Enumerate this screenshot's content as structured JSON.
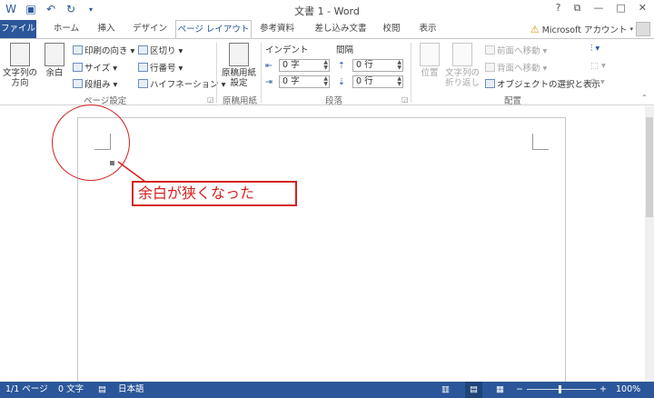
{
  "window": {
    "title": "文書 1 - Word",
    "controls": [
      "?",
      "⧉",
      "—",
      "□",
      "✕"
    ]
  },
  "qat": {
    "icons": [
      "word-logo-icon",
      "save-icon",
      "undo-icon",
      "redo-icon",
      "customize-qat-icon"
    ]
  },
  "tabs": [
    {
      "label": "ファイル"
    },
    {
      "label": "ホーム"
    },
    {
      "label": "挿入"
    },
    {
      "label": "デザイン"
    },
    {
      "label": "ページ レイアウト"
    },
    {
      "label": "参考資料"
    },
    {
      "label": "差し込み文書"
    },
    {
      "label": "校閲"
    },
    {
      "label": "表示"
    }
  ],
  "active_tab": "ページ レイアウト",
  "account": {
    "label": "Microsoft アカウント"
  },
  "ribbon": {
    "page_setup": {
      "text_direction": "文字列の方向",
      "margins": "余白",
      "orientation": "印刷の向き",
      "size": "サイズ",
      "columns": "段組み",
      "breaks": "区切り",
      "line_numbers": "行番号",
      "hyphenation": "ハイフネーション",
      "group_label": "ページ設定"
    },
    "manuscript": {
      "button": "原稿用紙設定",
      "group_label": "原稿用紙"
    },
    "paragraph": {
      "indent_label": "インデント",
      "spacing_label": "間隔",
      "indent_left": "0 字",
      "indent_right": "0 字",
      "spacing_before": "0 行",
      "spacing_after": "0 行",
      "group_label": "段落"
    },
    "arrange": {
      "position": "位置",
      "wrap_text": "文字列の折り返し",
      "bring_forward": "前面へ移動",
      "send_backward": "背面へ移動",
      "selection_pane": "オブジェクトの選択と表示",
      "group_label": "配置"
    }
  },
  "annotation": {
    "text": "余白が狭くなった",
    "color": "#d42020"
  },
  "status_bar": {
    "page": "1/1 ページ",
    "words": "0 文字",
    "language": "日本語",
    "zoom": "100%"
  },
  "colors": {
    "accent": "#2b579a"
  }
}
